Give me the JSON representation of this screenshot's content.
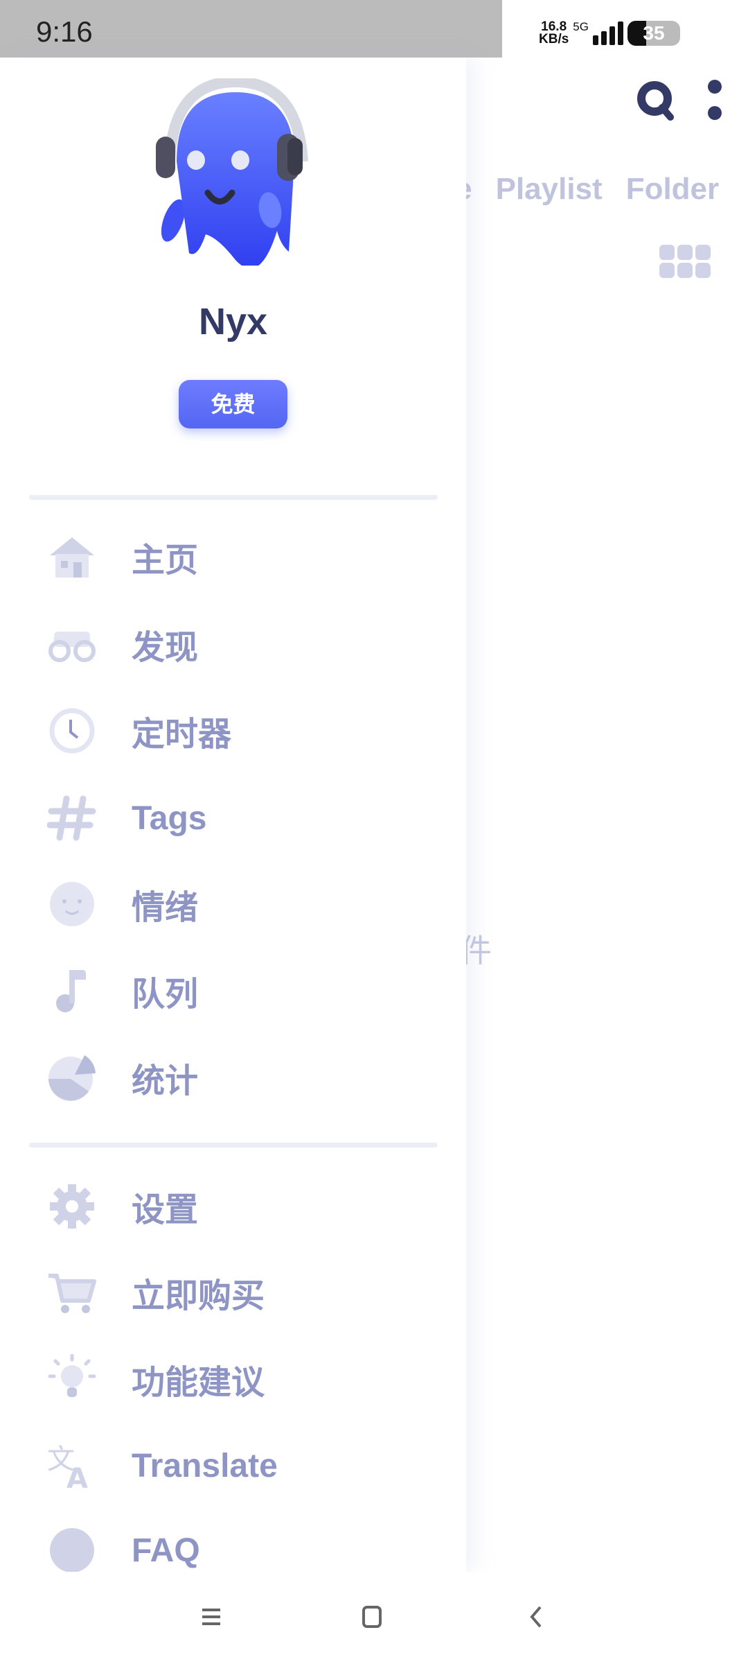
{
  "status_bar": {
    "time": "9:16",
    "speed": "16.8",
    "speed_unit": "KB/s",
    "network": "5G",
    "battery": "35"
  },
  "toolbar": {
    "search_icon": "search-icon",
    "more_icon": "more-vertical-icon"
  },
  "tabs": [
    "re",
    "Playlist",
    "Folder"
  ],
  "empty_text": "件",
  "drawer": {
    "user_name": "Nyx",
    "plan_badge": "免费",
    "section1": [
      {
        "label": "主页",
        "icon": "home-icon"
      },
      {
        "label": "发现",
        "icon": "binoculars-icon"
      },
      {
        "label": "定时器",
        "icon": "clock-icon"
      },
      {
        "label": "Tags",
        "icon": "hashtag-icon"
      },
      {
        "label": "情绪",
        "icon": "smile-icon"
      },
      {
        "label": "队列",
        "icon": "music-note-icon"
      },
      {
        "label": "统计",
        "icon": "pie-chart-icon"
      }
    ],
    "section2": [
      {
        "label": "设置",
        "icon": "gear-icon"
      },
      {
        "label": "立即购买",
        "icon": "cart-icon"
      },
      {
        "label": "功能建议",
        "icon": "lightbulb-icon"
      },
      {
        "label": "Translate",
        "icon": "translate-icon"
      },
      {
        "label": "FAQ",
        "icon": "question-icon"
      }
    ]
  },
  "colors": {
    "accent": "#5466f2",
    "menu_text": "#8e95c4",
    "icon": "#d0d3e8",
    "dark": "#333a66"
  }
}
